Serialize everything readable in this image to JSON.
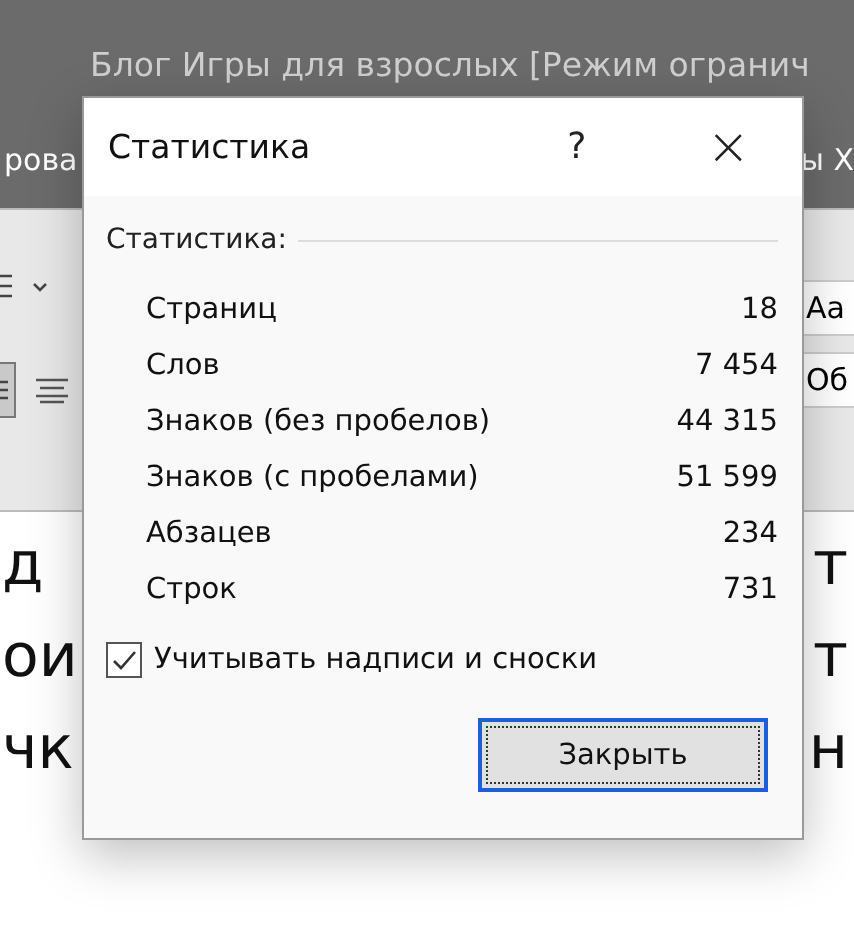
{
  "window": {
    "title": "Блог Игры для взрослых [Режим огранич"
  },
  "ribbon_tabs": {
    "left": "рова",
    "right": "ы Х"
  },
  "styles": [
    "Аа",
    "Об"
  ],
  "document_lines": [
    {
      "left": "д",
      "right": "т"
    },
    {
      "left": "ои",
      "right": "т"
    },
    {
      "left": "чк",
      "right": "н"
    }
  ],
  "dialog": {
    "title": "Статистика",
    "help": "?",
    "close": "×",
    "group_label": "Статистика:",
    "stats": [
      {
        "label": "Страниц",
        "value": "18"
      },
      {
        "label": "Слов",
        "value": "7 454"
      },
      {
        "label": "Знаков (без пробелов)",
        "value": "44 315"
      },
      {
        "label": "Знаков (с пробелами)",
        "value": "51 599"
      },
      {
        "label": "Абзацев",
        "value": "234"
      },
      {
        "label": "Строк",
        "value": "731"
      }
    ],
    "checkbox": {
      "label": "Учитывать надписи и сноски",
      "checked": true
    },
    "button": "Закрыть"
  }
}
